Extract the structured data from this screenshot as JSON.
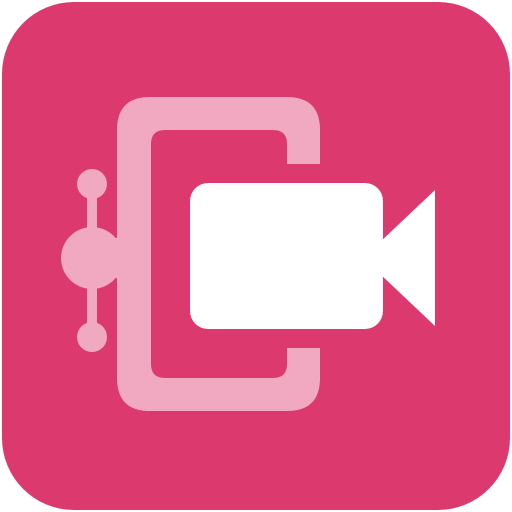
{
  "app_icon": {
    "name": "video-compressor-app-icon",
    "background_color": "#DC3A6E",
    "clamp_color": "#F0A9C1",
    "camera_color": "#FFFFFF",
    "icons": [
      "clamp-icon",
      "video-camera-icon"
    ]
  }
}
